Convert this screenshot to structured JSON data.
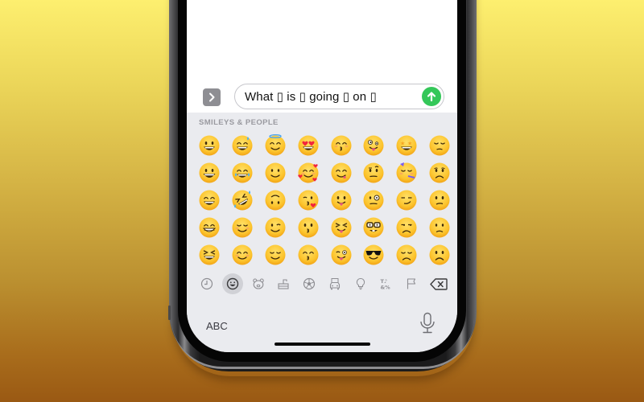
{
  "input_bar": {
    "app_button_icon": "chevron-right-icon",
    "message_text": "What ▯ is ▯ going ▯ on ▯",
    "send_button_icon": "arrow-up-icon",
    "accent_color": "#34c759"
  },
  "keyboard": {
    "section_title": "SMILEYS & PEOPLE",
    "emoji_rows": [
      [
        "grinning-face",
        "grinning-face-with-sweat",
        "smiling-face-with-halo",
        "smiling-face-with-heart-eyes",
        "kissing-face-with-closed-eyes",
        "zany-face",
        "star-struck",
        "pensive-face"
      ],
      [
        "grinning-face-with-big-eyes",
        "face-with-tears-of-joy",
        "slightly-smiling-face",
        "smiling-face-with-hearts",
        "face-savoring-food",
        "face-with-raised-eyebrow",
        "partying-face",
        "worried-face"
      ],
      [
        "grinning-face-with-smiling-eyes",
        "rolling-on-the-floor-laughing",
        "upside-down-face",
        "face-blowing-a-kiss",
        "face-with-tongue",
        "face-with-monocle",
        "smirking-face",
        "confused-face"
      ],
      [
        "beaming-face-with-smiling-eyes",
        "smiling-face",
        "winking-face",
        "kissing-face",
        "squinting-face-with-tongue",
        "nerd-face",
        "unamused-face",
        "slightly-frowning-face"
      ],
      [
        "grinning-squinting-face",
        "smiling-face-with-smiling-eyes",
        "relieved-face",
        "kissing-face-with-smiling-eyes",
        "winking-face-with-tongue",
        "smiling-face-with-sunglasses",
        "disappointed-face",
        "frowning-face"
      ]
    ],
    "categories": [
      {
        "name": "recent",
        "icon": "clock-icon",
        "active": false
      },
      {
        "name": "smileys-people",
        "icon": "smiley-icon",
        "active": true
      },
      {
        "name": "animals-nature",
        "icon": "bear-icon",
        "active": false
      },
      {
        "name": "food-drink",
        "icon": "cake-icon",
        "active": false
      },
      {
        "name": "activity",
        "icon": "soccer-ball-icon",
        "active": false
      },
      {
        "name": "travel-places",
        "icon": "car-icon",
        "active": false
      },
      {
        "name": "objects",
        "icon": "lightbulb-icon",
        "active": false
      },
      {
        "name": "symbols",
        "icon": "symbols-icon",
        "active": false
      },
      {
        "name": "flags",
        "icon": "flag-icon",
        "active": false
      },
      {
        "name": "delete",
        "icon": "backspace-icon",
        "active": false
      }
    ],
    "abc_label": "ABC",
    "mic_icon": "microphone-icon"
  }
}
